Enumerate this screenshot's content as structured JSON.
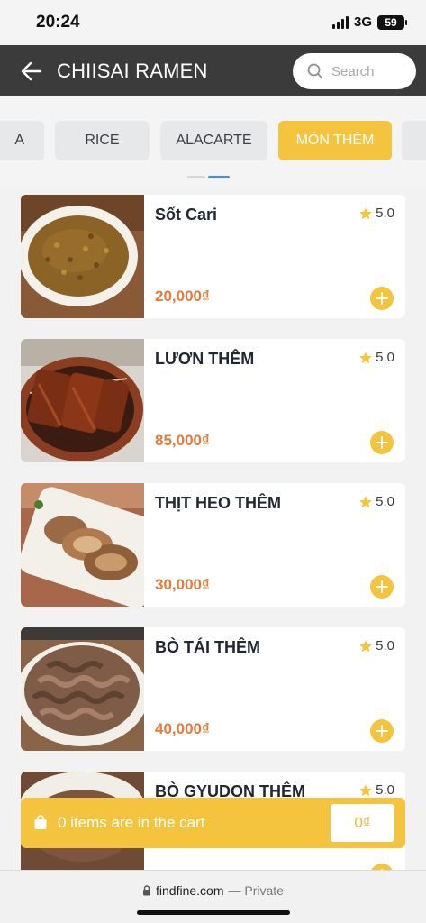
{
  "status_bar": {
    "time": "20:24",
    "network": "3G",
    "battery": "59"
  },
  "header": {
    "title": "CHIISAI RAMEN",
    "search_placeholder": "Search"
  },
  "categories": [
    {
      "label": "A",
      "active": false
    },
    {
      "label": "RICE",
      "active": false
    },
    {
      "label": "ALACARTE",
      "active": false
    },
    {
      "label": "MÓN THÊM",
      "active": true
    }
  ],
  "products": [
    {
      "name": "Sốt Cari",
      "rating": "5.0",
      "price": "20,000₫",
      "image": "curry-sauce-bowl"
    },
    {
      "name": "LƯƠN THÊM",
      "rating": "5.0",
      "price": "85,000₫",
      "image": "grilled-eel-skewers"
    },
    {
      "name": "THỊT HEO THÊM",
      "rating": "5.0",
      "price": "30,000₫",
      "image": "pork-slices-plate"
    },
    {
      "name": "BÒ TÁI THÊM",
      "rating": "5.0",
      "price": "40,000₫",
      "image": "beef-slices-bowl"
    },
    {
      "name": "BÒ GYUDON THÊM",
      "rating": "5.0",
      "price": "",
      "image": "gyudon-beef"
    }
  ],
  "cart": {
    "label": "0 items are in the cart",
    "total": "0₫"
  },
  "browser": {
    "domain": "findfine.com",
    "mode": "— Private"
  },
  "colors": {
    "header_bg": "#3b3b3b",
    "accent": "#f5c43f",
    "price": "#e57b3b",
    "tab_bg": "#e7e8ea"
  }
}
